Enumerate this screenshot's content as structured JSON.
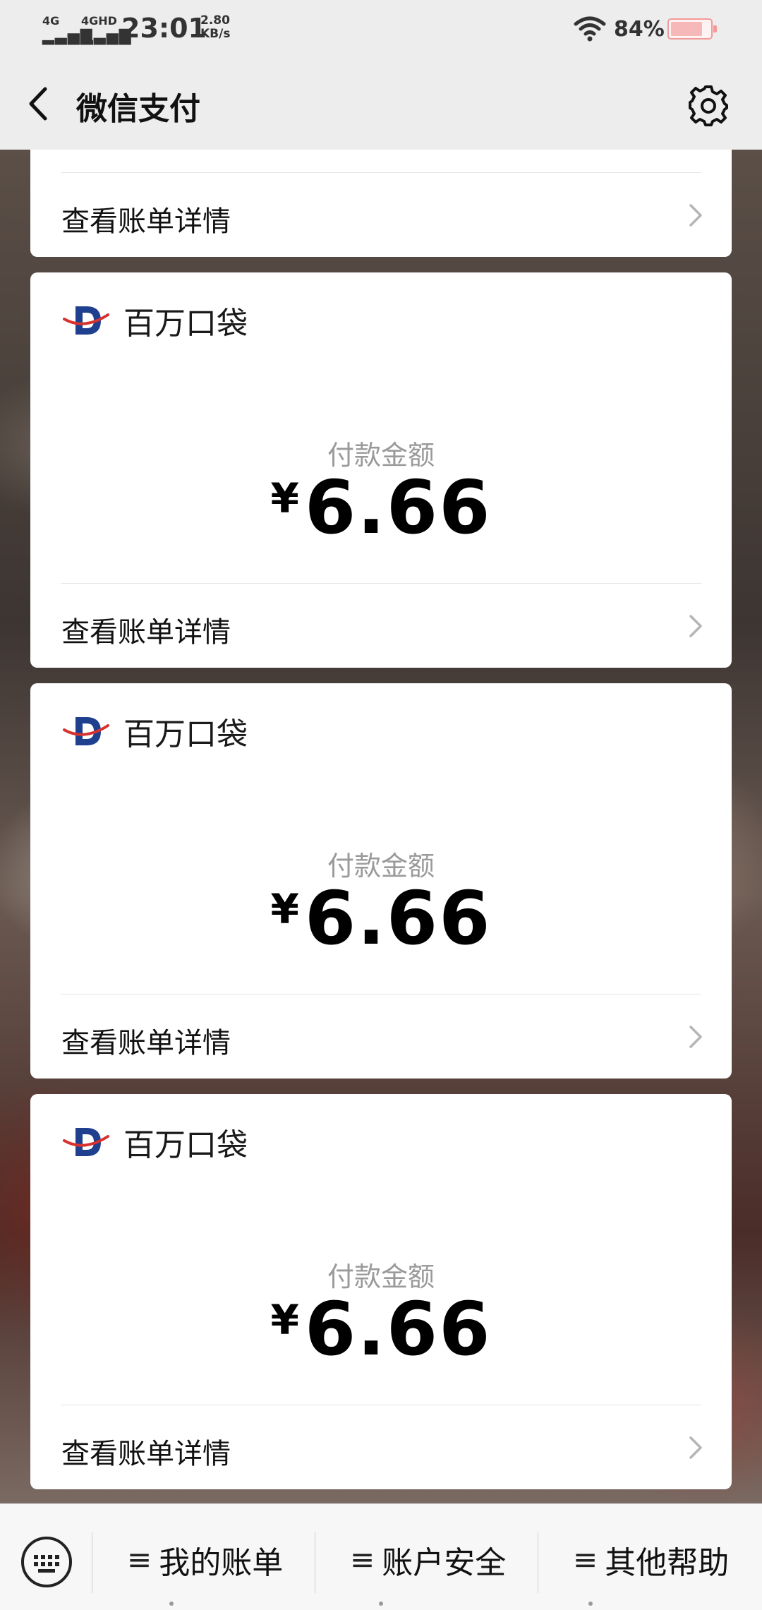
{
  "status_bar": {
    "signal1_label": "4G",
    "signal2_label": "4GHD",
    "time": "23:01",
    "speed_value": "2.80",
    "speed_unit": "KB/s",
    "battery_percent_text": "84%",
    "battery_level": 0.84,
    "battery_color": "#f29a9a"
  },
  "header": {
    "title": "微信支付",
    "back_icon": "chevron-left-icon",
    "settings_icon": "gear-icon"
  },
  "partial_card": {
    "detail_label": "查看账单详情"
  },
  "cards": [
    {
      "merchant_name": "百万口袋",
      "amount_label": "付款金额",
      "currency_symbol": "¥",
      "amount": "6.66",
      "detail_label": "查看账单详情"
    },
    {
      "merchant_name": "百万口袋",
      "amount_label": "付款金额",
      "currency_symbol": "¥",
      "amount": "6.66",
      "detail_label": "查看账单详情"
    },
    {
      "merchant_name": "百万口袋",
      "amount_label": "付款金额",
      "currency_symbol": "¥",
      "amount": "6.66",
      "detail_label": "查看账单详情"
    }
  ],
  "bottom_bar": {
    "keyboard_icon": "keyboard-icon",
    "menu": [
      {
        "label": "我的账单"
      },
      {
        "label": "账户安全"
      },
      {
        "label": "其他帮助"
      }
    ]
  },
  "colors": {
    "card_bg": "#ffffff",
    "header_bg": "#ededed",
    "logo_blue": "#1f3f8f",
    "logo_red": "#d6332f"
  }
}
